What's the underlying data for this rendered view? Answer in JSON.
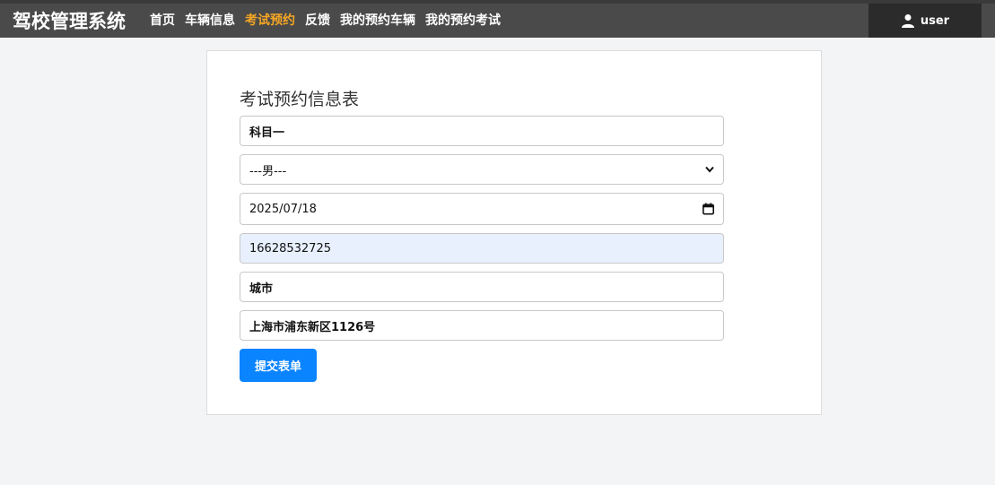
{
  "header": {
    "brand": "驾校管理系统",
    "nav": [
      {
        "label": "首页",
        "active": false
      },
      {
        "label": "车辆信息",
        "active": false
      },
      {
        "label": "考试预约",
        "active": true
      },
      {
        "label": "反馈",
        "active": false
      },
      {
        "label": "我的预约车辆",
        "active": false
      },
      {
        "label": "我的预约考试",
        "active": false
      }
    ],
    "user": {
      "name": "user",
      "icon": "user-icon"
    },
    "active_color": "#f5a623"
  },
  "form": {
    "title": "考试预约信息表",
    "subject": "科目一",
    "gender_select": "---男---",
    "date": "2025/07/18",
    "phone": "16628532725",
    "city": "城市",
    "address": "上海市浦东新区1126号",
    "submit_label": "提交表单"
  }
}
